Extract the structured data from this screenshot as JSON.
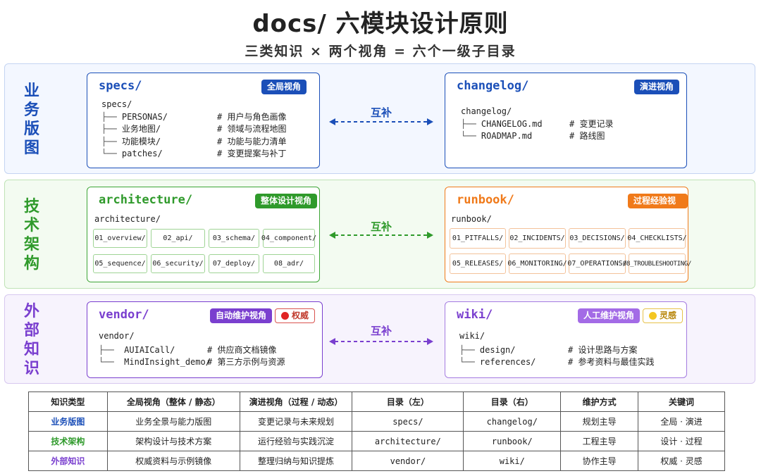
{
  "title": "docs/ 六模块设计原则",
  "subtitle": "三类知识 × 两个视角 = 六个一级子目录",
  "colors": {
    "biz": "#1b4fb8",
    "tech": "#2f9a2b",
    "ext": "#7a3fcf",
    "orange": "#f07a1a"
  },
  "complement_label": "互补",
  "rows": {
    "biz": {
      "label": [
        "业",
        "务",
        "版",
        "图"
      ]
    },
    "tech": {
      "label": [
        "技",
        "术",
        "架",
        "构"
      ]
    },
    "ext": {
      "label": [
        "外",
        "部",
        "知",
        "识"
      ]
    }
  },
  "specs": {
    "title": "specs/",
    "badge": "全局视角",
    "root": "specs/",
    "items": [
      {
        "prefix": "├──",
        "name": "PERSONAS/",
        "comment": "# 用户与角色画像"
      },
      {
        "prefix": "├──",
        "name": "业务地图/",
        "comment": "# 领域与流程地图"
      },
      {
        "prefix": "├──",
        "name": "功能模块/",
        "comment": "# 功能与能力清单"
      },
      {
        "prefix": "└──",
        "name": "patches/",
        "comment": "# 变更提案与补丁"
      }
    ]
  },
  "changelog": {
    "title": "changelog/",
    "badge": "演进视角",
    "root": "changelog/",
    "items": [
      {
        "prefix": "├──",
        "name": "CHANGELOG.md",
        "comment": "# 变更记录"
      },
      {
        "prefix": "└──",
        "name": "ROADMAP.md",
        "comment": "# 路线图"
      }
    ]
  },
  "architecture": {
    "title": "architecture/",
    "badge": "整体设计视角",
    "root": "architecture/",
    "cells": [
      "01_overview/",
      "02_api/",
      "03_schema/",
      "04_component/",
      "05_sequence/",
      "06_security/",
      "07_deploy/",
      "08_adr/"
    ]
  },
  "runbook": {
    "title": "runbook/",
    "badge": "过程经验视角",
    "root": "runbook/",
    "cells": [
      "01_PITFALLS/",
      "02_INCIDENTS/",
      "03_DECISIONS/",
      "04_CHECKLISTS/",
      "05_RELEASES/",
      "06_MONITORING/",
      "07_OPERATIONS/",
      "08_TROUBLESHOOTING/"
    ]
  },
  "vendor": {
    "title": "vendor/",
    "badge": "自动维护视角",
    "badge2": "权威",
    "root": "vendor/",
    "items": [
      {
        "prefix": "├──",
        "name": "AUIAICall/",
        "comment": "# 供应商文档镜像"
      },
      {
        "prefix": "└──",
        "name": "MindInsight_demo/",
        "comment": "# 第三方示例与资源"
      }
    ]
  },
  "wiki": {
    "title": "wiki/",
    "badge": "人工维护视角",
    "badge2": "灵感",
    "root": "wiki/",
    "items": [
      {
        "prefix": "├──",
        "name": "design/",
        "comment": "# 设计思路与方案"
      },
      {
        "prefix": "└──",
        "name": "references/",
        "comment": "# 参考资料与最佳实践"
      }
    ]
  },
  "table": {
    "headers": [
      "知识类型",
      "全局视角（整体 / 静态）",
      "演进视角（过程 / 动态）",
      "目录（左）",
      "目录（右）",
      "维护方式",
      "关键词"
    ],
    "rows": [
      [
        "业务版图",
        "业务全景与能力版图",
        "变更记录与未来规划",
        "specs/",
        "changelog/",
        "规划主导",
        "全局 · 演进"
      ],
      [
        "技术架构",
        "架构设计与技术方案",
        "运行经验与实践沉淀",
        "architecture/",
        "runbook/",
        "工程主导",
        "设计 · 过程"
      ],
      [
        "外部知识",
        "权威资料与示例镜像",
        "整理归纳与知识提炼",
        "vendor/",
        "wiki/",
        "协作主导",
        "权威 · 灵感"
      ]
    ]
  }
}
